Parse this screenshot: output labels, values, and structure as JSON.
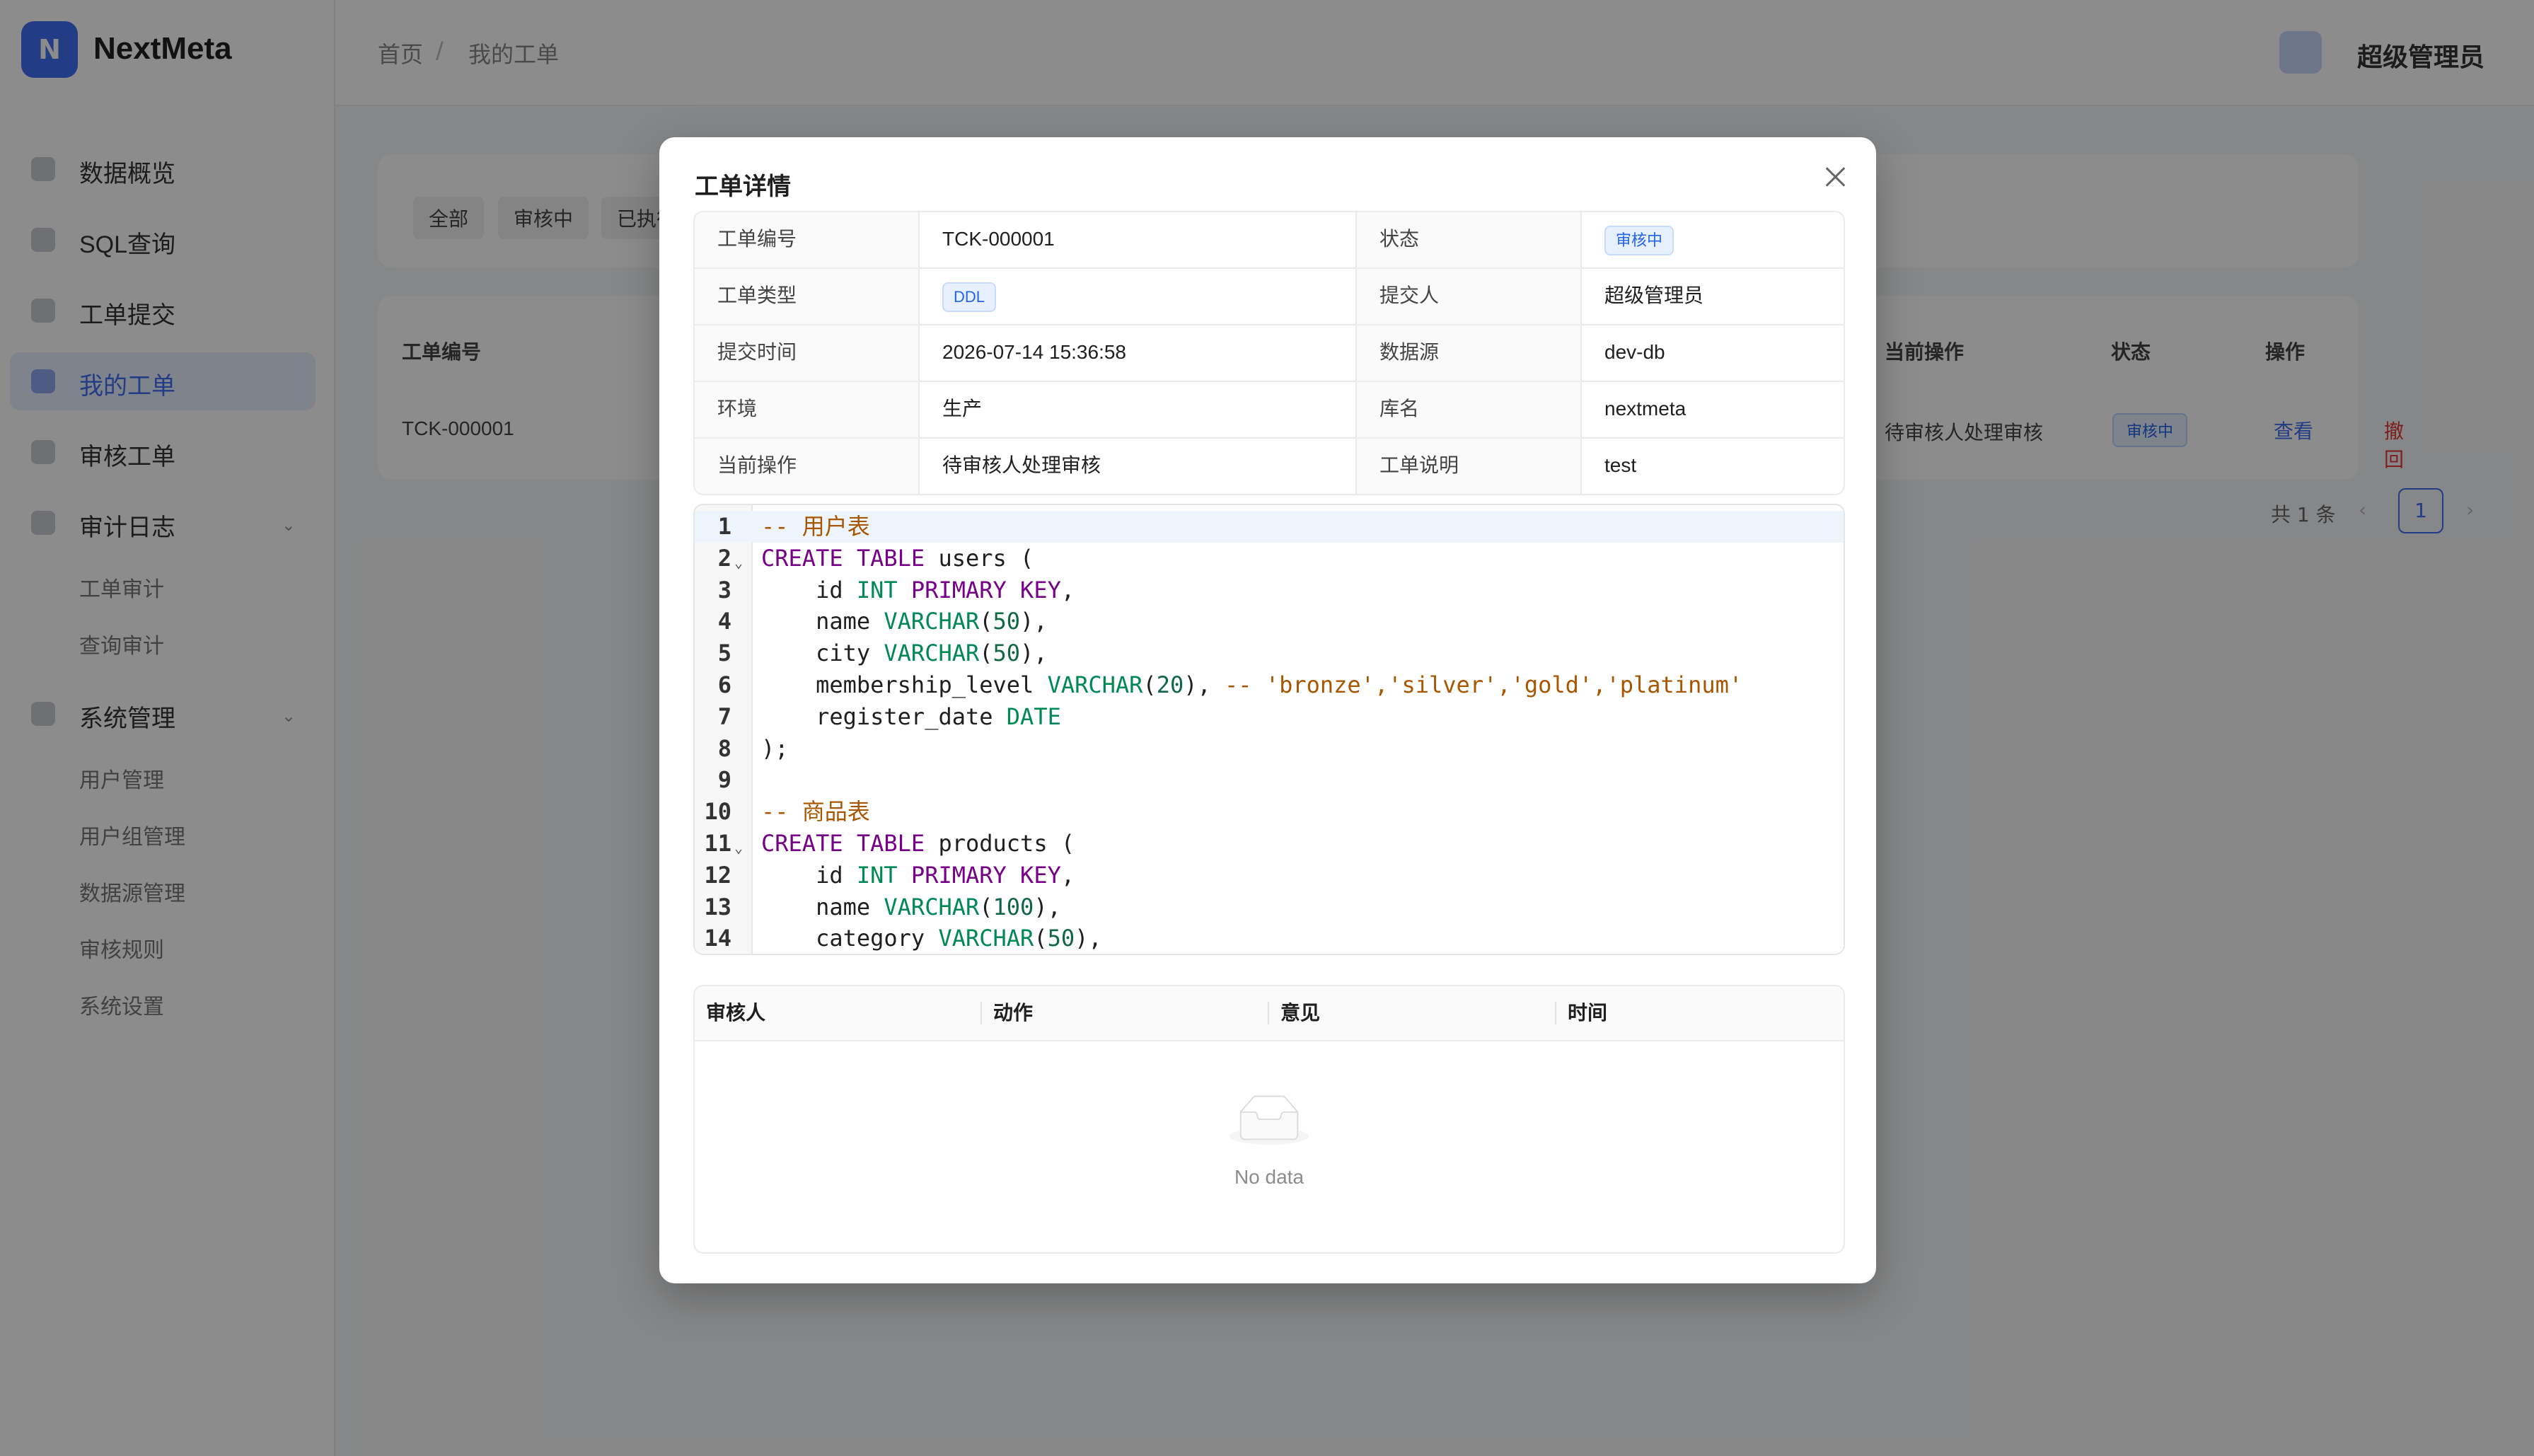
{
  "app": {
    "logo_letter": "N",
    "brand": "NextMeta"
  },
  "sidebar": {
    "items": [
      {
        "label": "数据概览"
      },
      {
        "label": "SQL查询"
      },
      {
        "label": "工单提交"
      },
      {
        "label": "我的工单"
      },
      {
        "label": "审核工单"
      },
      {
        "label": "审计日志"
      },
      {
        "label": "系统管理"
      }
    ],
    "audit_sub": [
      "工单审计",
      "查询审计"
    ],
    "system_sub": [
      "用户管理",
      "用户组管理",
      "数据源管理",
      "审核规则",
      "系统设置"
    ]
  },
  "header": {
    "breadcrumb": [
      "首页",
      "我的工单"
    ],
    "user_name": "超级管理员"
  },
  "background_list": {
    "filter_tabs": [
      "全部",
      "审核中",
      "已执行"
    ],
    "columns": [
      "工单编号",
      "当前操作",
      "状态",
      "操作"
    ],
    "row": {
      "id": "TCK-000001",
      "current_op": "待审核人处理审核",
      "status": "审核中",
      "view": "查看",
      "withdraw": "撤回"
    },
    "pager": {
      "total": "共 1 条",
      "page": "1"
    }
  },
  "modal": {
    "title": "工单详情",
    "details": {
      "ticket_no_label": "工单编号",
      "ticket_no": "TCK-000001",
      "status_label": "状态",
      "status": "审核中",
      "type_label": "工单类型",
      "type": "DDL",
      "submitter_label": "提交人",
      "submitter": "超级管理员",
      "submit_time_label": "提交时间",
      "submit_time": "2026-07-14 15:36:58",
      "datasource_label": "数据源",
      "datasource": "dev-db",
      "env_label": "环境",
      "env": "生产",
      "dbname_label": "库名",
      "dbname": "nextmeta",
      "current_op_label": "当前操作",
      "current_op": "待审核人处理审核",
      "remark_label": "工单说明",
      "remark": "test"
    },
    "code": {
      "language": "sql",
      "lines": [
        "-- 用户表",
        "CREATE TABLE users (",
        "    id INT PRIMARY KEY,",
        "    name VARCHAR(50),",
        "    city VARCHAR(50),",
        "    membership_level VARCHAR(20), -- 'bronze','silver','gold','platinum'",
        "    register_date DATE",
        ");",
        "",
        "-- 商品表",
        "CREATE TABLE products (",
        "    id INT PRIMARY KEY,",
        "    name VARCHAR(100),",
        "    category VARCHAR(50),"
      ]
    },
    "review": {
      "columns": [
        "审核人",
        "动作",
        "意见",
        "时间"
      ],
      "empty_text": "No data"
    }
  },
  "colors": {
    "accent": "#3f6df2",
    "tag_blue": "#2563eb",
    "keyword": "#770088",
    "type": "#008855",
    "comment": "#aa5500"
  }
}
